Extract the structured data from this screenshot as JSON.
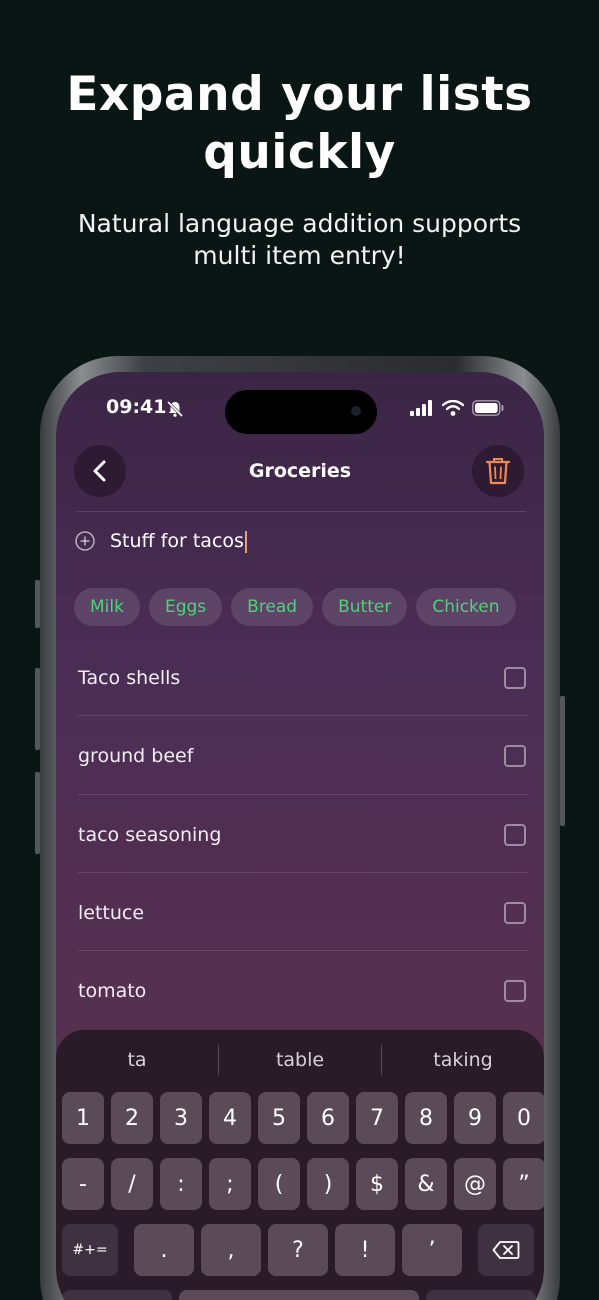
{
  "promo": {
    "headline_line1": "Expand your lists",
    "headline_line2": "quickly",
    "subline_line1": "Natural language addition supports",
    "subline_line2": "multi item entry!"
  },
  "status_bar": {
    "time": "09:41"
  },
  "nav": {
    "title": "Groceries",
    "back_icon": "chevron-left-icon",
    "delete_icon": "trash-icon"
  },
  "input": {
    "value": "Stuff for tacos",
    "add_icon": "plus-circle-icon"
  },
  "chips": [
    "Milk",
    "Eggs",
    "Bread",
    "Butter",
    "Chicken"
  ],
  "items": [
    "Taco shells",
    "ground beef",
    "taco seasoning",
    "lettuce",
    "tomato"
  ],
  "keyboard": {
    "suggestions": [
      "ta",
      "table",
      "taking"
    ],
    "row1": [
      "1",
      "2",
      "3",
      "4",
      "5",
      "6",
      "7",
      "8",
      "9",
      "0"
    ],
    "row2": [
      "-",
      "/",
      ":",
      ";",
      "(",
      ")",
      "$",
      "&",
      "@",
      "”"
    ],
    "row3": [
      "#+=",
      ".",
      ",",
      "?",
      "!",
      "’"
    ]
  },
  "colors": {
    "background": "#0a1614",
    "chip_text": "#4ed27a",
    "trash": "#f08a50",
    "caret": "#f0a060"
  }
}
